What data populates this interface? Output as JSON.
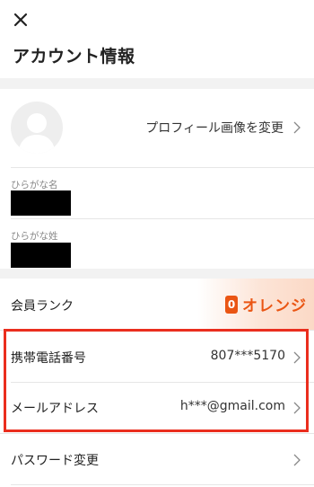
{
  "header": {
    "close_icon": "close-icon",
    "title": "アカウント情報"
  },
  "profile": {
    "avatar_icon": "default-avatar-icon",
    "change_image_label": "プロフィール画像を変更"
  },
  "name_fields": [
    {
      "label": "ひらがな名",
      "value_redacted": true
    },
    {
      "label": "ひらがな姓",
      "value_redacted": true
    }
  ],
  "membership": {
    "label": "会員ランク",
    "badge": "0",
    "rank_name": "オレンジ",
    "accent_color": "#ea5513"
  },
  "rows": {
    "phone": {
      "label": "携帯電話番号",
      "value": "807***5170"
    },
    "email": {
      "label": "メールアドレス",
      "value": "h***@gmail.com"
    },
    "password": {
      "label": "パスワード変更"
    }
  },
  "annotation": {
    "highlight_color": "#ea2e1e"
  }
}
